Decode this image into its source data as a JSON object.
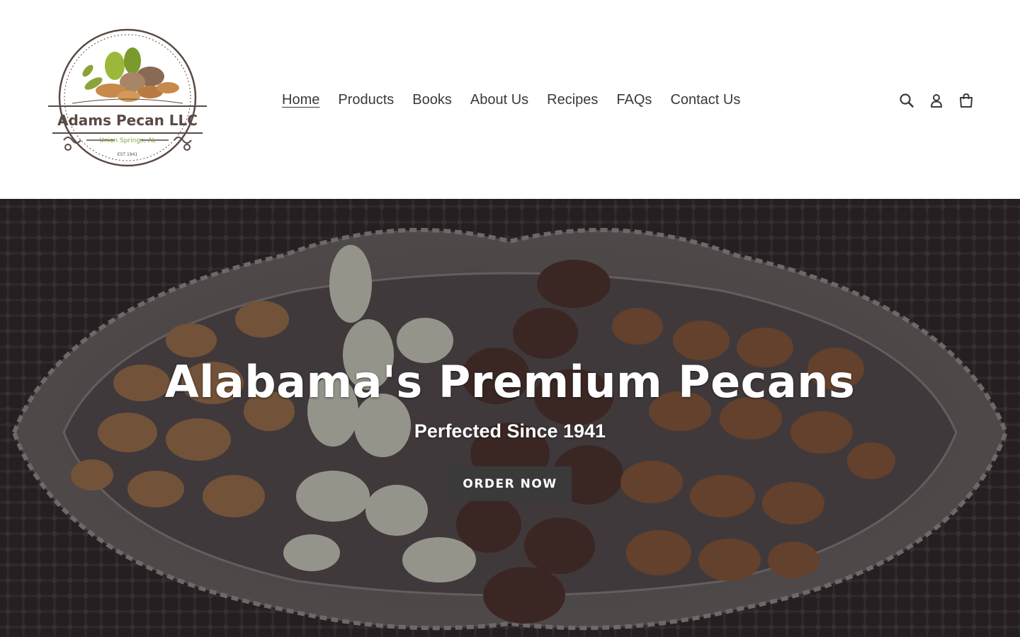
{
  "logo": {
    "name": "Adams Pecan LLC",
    "location": "Union Springs, AL",
    "established": "EST 1941"
  },
  "nav": {
    "items": [
      {
        "label": "Home",
        "active": true
      },
      {
        "label": "Products"
      },
      {
        "label": "Books"
      },
      {
        "label": "About Us"
      },
      {
        "label": "Recipes"
      },
      {
        "label": "FAQs"
      },
      {
        "label": "Contact Us"
      }
    ]
  },
  "header_icons": [
    "search-icon",
    "account-icon",
    "cart-icon"
  ],
  "hero": {
    "title": "Alabama's Premium Pecans",
    "subtitle": "Perfected Since 1941",
    "button_label": "ORDER NOW"
  },
  "colors": {
    "text": "#3a3a3a",
    "button_bg": "#3a3a3a",
    "logo_brown": "#5a4a44",
    "logo_green": "#8aa33a"
  }
}
